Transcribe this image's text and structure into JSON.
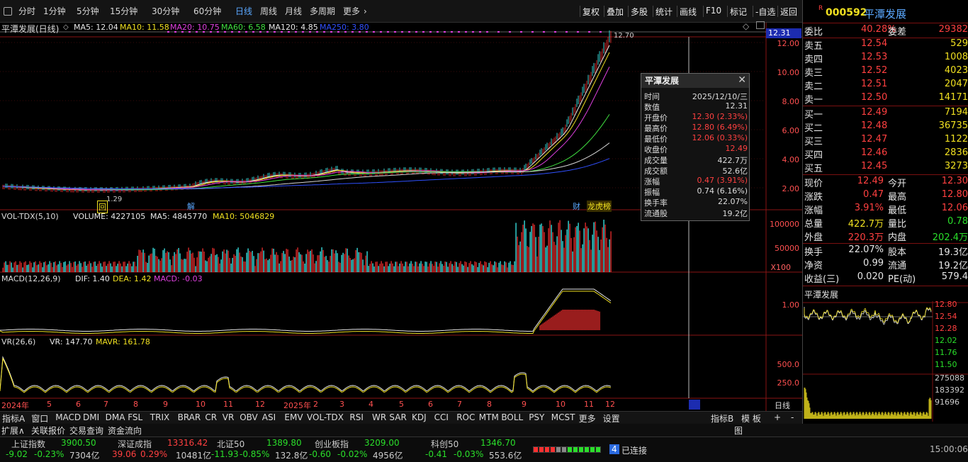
{
  "toolbar": {
    "periods": [
      "分时",
      "1分钟",
      "5分钟",
      "15分钟",
      "30分钟",
      "60分钟",
      "日线",
      "周线",
      "月线",
      "多周期",
      "更多"
    ],
    "active_period": "日线",
    "right_buttons": [
      "复权",
      "叠加",
      "多股",
      "统计",
      "画线",
      "F10",
      "标记",
      "-自选",
      "返回"
    ]
  },
  "chart_header": {
    "title": "平潭发展(日线)",
    "ma5": "MA5: 12.04",
    "ma10": "MA10: 11.58",
    "ma20": "MA20: 10.75",
    "ma60": "MA60: 6.58",
    "ma120": "MA120: 4.85",
    "ma250": "MA250: 3.80",
    "cursor_price": "12.31",
    "high_marker": "12.70",
    "low_marker": "1.29",
    "badge_hui": "回",
    "badge_jie": "解",
    "badge_cai": "财",
    "badge_long": "龙虎榜"
  },
  "price_axis": [
    "12.00",
    "10.00",
    "8.00",
    "6.00",
    "4.00",
    "2.00"
  ],
  "vol_panel": {
    "label": "VOL-TDX(5,10)",
    "volume": "VOLUME: 4227105",
    "ma5": "MA5: 4845770",
    "ma10": "MA10: 5046829",
    "axis": [
      "100000",
      "50000"
    ],
    "unit": "X100"
  },
  "macd_panel": {
    "label": "MACD(12,26,9)",
    "dif": "DIF: 1.40",
    "dea": "DEA: 1.42",
    "macd": "MACD: -0.03",
    "axis": [
      "1.00"
    ]
  },
  "vr_panel": {
    "label": "VR(26,6)",
    "vr": "VR: 147.70",
    "mavr": "MAVR: 161.78",
    "axis": [
      "500.0",
      "250.0"
    ]
  },
  "time_axis": [
    "2024年",
    "5",
    "6",
    "7",
    "8",
    "9",
    "10",
    "11",
    "12",
    "2025年",
    "2",
    "3",
    "4",
    "5",
    "6",
    "7",
    "8",
    "9",
    "10",
    "11",
    "12"
  ],
  "time_axis_right": "日线",
  "popup": {
    "title": "平潭发展",
    "rows": [
      {
        "k": "时间",
        "v": "2025/12/10/三"
      },
      {
        "k": "数值",
        "v": "12.31"
      },
      {
        "k": "开盘价",
        "v": "12.30 (2.33%)"
      },
      {
        "k": "最高价",
        "v": "12.80 (6.49%)"
      },
      {
        "k": "最低价",
        "v": "12.06 (0.33%)"
      },
      {
        "k": "收盘价",
        "v": "12.49"
      },
      {
        "k": "成交量",
        "v": "422.7万"
      },
      {
        "k": "成交额",
        "v": "52.6亿"
      },
      {
        "k": "涨幅",
        "v": "0.47 (3.91%)"
      },
      {
        "k": "振幅",
        "v": "0.74 (6.16%)"
      },
      {
        "k": "换手率",
        "v": "22.07%"
      },
      {
        "k": "流通股",
        "v": "19.2亿"
      }
    ]
  },
  "indicator_tabs": [
    "指标A",
    "窗口",
    "MACD",
    "DMI",
    "DMA",
    "FSL",
    "TRIX",
    "BRAR",
    "CR",
    "VR",
    "OBV",
    "ASI",
    "EMV",
    "VOL-TDX",
    "RSI",
    "WR",
    "SAR",
    "KDJ",
    "CCI",
    "ROC",
    "MTM",
    "BOLL",
    "PSY",
    "MCST",
    "更多",
    "设置"
  ],
  "indicator_tab_b": "指标B",
  "indicator_tab_board": "模 板",
  "indicator_tab_plus": "+",
  "indicator_tab_minus": "-",
  "sub_tabs": [
    "扩展∧",
    "关联报价",
    "交易查询",
    "资金流向"
  ],
  "sub_tab_right": "图",
  "status_bar": [
    {
      "name": "上证指数",
      "value": "3900.50",
      "chg": "-9.02",
      "pct": "-0.23%",
      "amt": "7304亿",
      "color": "green"
    },
    {
      "name": "深证成指",
      "value": "13316.42",
      "chg": "39.06",
      "pct": "0.29%",
      "amt": "10481亿",
      "color": "red"
    },
    {
      "name": "北证50",
      "value": "1389.80",
      "chg": "-11.93",
      "pct": "-0.85%",
      "amt": "132.8亿",
      "color": "green"
    },
    {
      "name": "创业板指",
      "value": "3209.00",
      "chg": "-0.60",
      "pct": "-0.02%",
      "amt": "4956亿",
      "color": "green"
    },
    {
      "name": "科创50",
      "value": "1346.70",
      "chg": "-0.41",
      "pct": "-0.03%",
      "amt": "553.6亿",
      "color": "green"
    }
  ],
  "connection": {
    "num": "4",
    "label": "已连接"
  },
  "clock": "15:00:06",
  "quote": {
    "code": "000592",
    "name": "平潭发展",
    "r_badge": "R",
    "weibi_label": "委比",
    "weibi": "40.28%",
    "weicha_label": "委差",
    "weicha": "29382",
    "sells": [
      {
        "label": "卖五",
        "price": "12.54",
        "vol": "529"
      },
      {
        "label": "卖四",
        "price": "12.53",
        "vol": "1008"
      },
      {
        "label": "卖三",
        "price": "12.52",
        "vol": "4023"
      },
      {
        "label": "卖二",
        "price": "12.51",
        "vol": "2047"
      },
      {
        "label": "卖一",
        "price": "12.50",
        "vol": "14171"
      }
    ],
    "buys": [
      {
        "label": "买一",
        "price": "12.49",
        "vol": "7194"
      },
      {
        "label": "买二",
        "price": "12.48",
        "vol": "36735"
      },
      {
        "label": "买三",
        "price": "12.47",
        "vol": "1122"
      },
      {
        "label": "买四",
        "price": "12.46",
        "vol": "2836"
      },
      {
        "label": "买五",
        "price": "12.45",
        "vol": "3273"
      }
    ],
    "stats": [
      {
        "l1": "现价",
        "v1": "12.49",
        "c1": "red",
        "l2": "今开",
        "v2": "12.30",
        "c2": "red"
      },
      {
        "l1": "涨跌",
        "v1": "0.47",
        "c1": "red",
        "l2": "最高",
        "v2": "12.80",
        "c2": "red"
      },
      {
        "l1": "涨幅",
        "v1": "3.91%",
        "c1": "red",
        "l2": "最低",
        "v2": "12.06",
        "c2": "red"
      },
      {
        "l1": "总量",
        "v1": "422.7万",
        "c1": "yellow",
        "l2": "量比",
        "v2": "0.78",
        "c2": "green"
      },
      {
        "l1": "外盘",
        "v1": "220.3万",
        "c1": "red",
        "l2": "内盘",
        "v2": "202.4万",
        "c2": "green"
      }
    ],
    "stats2": [
      {
        "l1": "换手",
        "v1": "22.07%",
        "l2": "股本",
        "v2": "19.3亿"
      },
      {
        "l1": "净资",
        "v1": "0.99",
        "l2": "流通",
        "v2": "19.2亿"
      },
      {
        "l1": "收益(三)",
        "v1": "0.020",
        "l2": "PE(动)",
        "v2": "579.4"
      }
    ],
    "mini_title": "平潭发展",
    "mini_price_axis": [
      "12.80",
      "12.54",
      "12.28",
      "12.02",
      "11.76",
      "11.50"
    ],
    "mini_vol_axis": [
      "275088",
      "183392",
      "91696"
    ]
  }
}
